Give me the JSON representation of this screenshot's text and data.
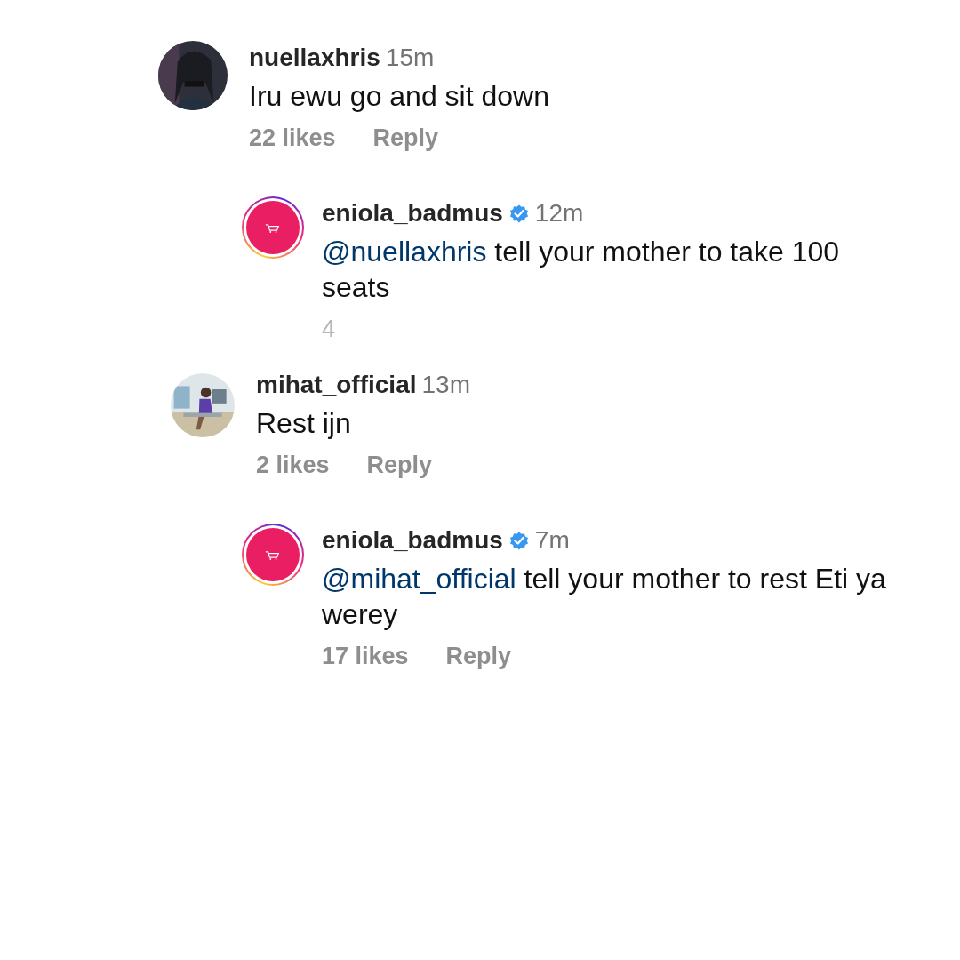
{
  "comments": [
    {
      "username": "nuellaxhris",
      "verified": false,
      "time": "15m",
      "avatar": {
        "kind": "picture"
      },
      "text": "Iru ewu go and sit down",
      "likes": "22 likes",
      "likes_faded": false,
      "reply_label": "Reply",
      "replies": [
        {
          "username": "eniola_badmus",
          "verified": true,
          "time": "12m",
          "avatar": {
            "kind": "logo",
            "ring": true
          },
          "mention": "@nuellaxhris",
          "text": "tell your mother to take 100 seats",
          "likes": "4",
          "likes_faded": true
        }
      ]
    },
    {
      "username": "mihat_official",
      "verified": false,
      "time": "13m",
      "avatar": {
        "kind": "picture"
      },
      "text": "Rest ijn",
      "likes": "2 likes",
      "likes_faded": false,
      "reply_label": "Reply",
      "replies": [
        {
          "username": "eniola_badmus",
          "verified": true,
          "time": "7m",
          "avatar": {
            "kind": "logo",
            "ring": true
          },
          "mention": "@mihat_official",
          "text": "tell your mother to rest Eti ya werey",
          "likes": "17 likes",
          "likes_faded": false,
          "reply_label": "Reply"
        }
      ]
    }
  ]
}
